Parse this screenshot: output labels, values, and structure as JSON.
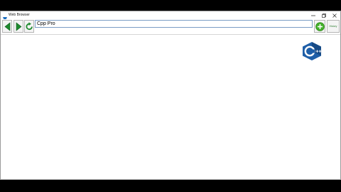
{
  "window": {
    "title": "Web Browser"
  },
  "toolbar": {
    "back_icon": "back-arrow-icon",
    "forward_icon": "forward-arrow-icon",
    "refresh_icon": "refresh-icon",
    "address_value": "Cpp Pro",
    "go_icon": "add-go-icon",
    "history_label": "History"
  },
  "content": {
    "logo_text": "C++",
    "logo_icon": "cpp-logo-icon"
  },
  "colors": {
    "nav_green": "#1e8a2e",
    "go_green": "#43b02a",
    "logo_blue": "#1f5fa8",
    "address_border": "#7a9cc4"
  }
}
